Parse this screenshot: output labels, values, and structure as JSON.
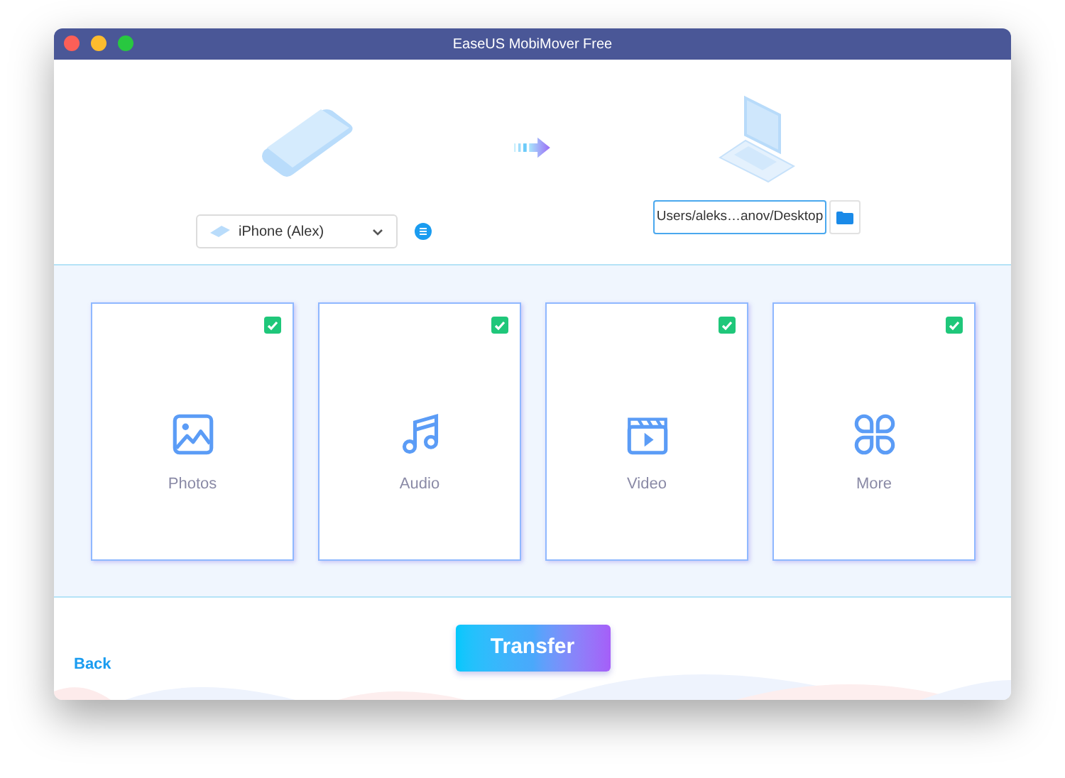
{
  "window": {
    "title": "EaseUS MobiMover Free"
  },
  "source": {
    "device": "iPhone (Alex)"
  },
  "destination": {
    "path": "Users/aleks…anov/Desktop"
  },
  "categories": [
    {
      "label": "Photos",
      "kind": "photos",
      "checked": true
    },
    {
      "label": "Audio",
      "kind": "audio",
      "checked": true
    },
    {
      "label": "Video",
      "kind": "video",
      "checked": true
    },
    {
      "label": "More",
      "kind": "more",
      "checked": true
    }
  ],
  "transfer_button": "Transfer",
  "back_link": "Back"
}
